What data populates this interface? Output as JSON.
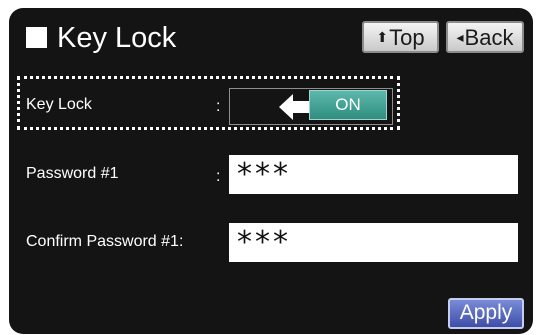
{
  "header": {
    "title": "Key Lock",
    "top_button": {
      "glyph": "⬆",
      "label": "Top"
    },
    "back_button": {
      "glyph": "◂",
      "label": "Back"
    }
  },
  "form": {
    "key_lock": {
      "label": "Key Lock",
      "colon": ":",
      "toggle_value": "ON"
    },
    "password": {
      "label": "Password  #1",
      "colon": ":",
      "value": "***"
    },
    "confirm_password": {
      "label": "Confirm Password  #1:",
      "value": "***"
    }
  },
  "footer": {
    "apply_label": "Apply"
  },
  "icons": {
    "title_marker": "square-icon",
    "toggle_hint": "left-arrow-icon"
  },
  "colors": {
    "background": "#141414",
    "toggle_on": "#3fa394",
    "apply_button": "#4f5fbf"
  }
}
